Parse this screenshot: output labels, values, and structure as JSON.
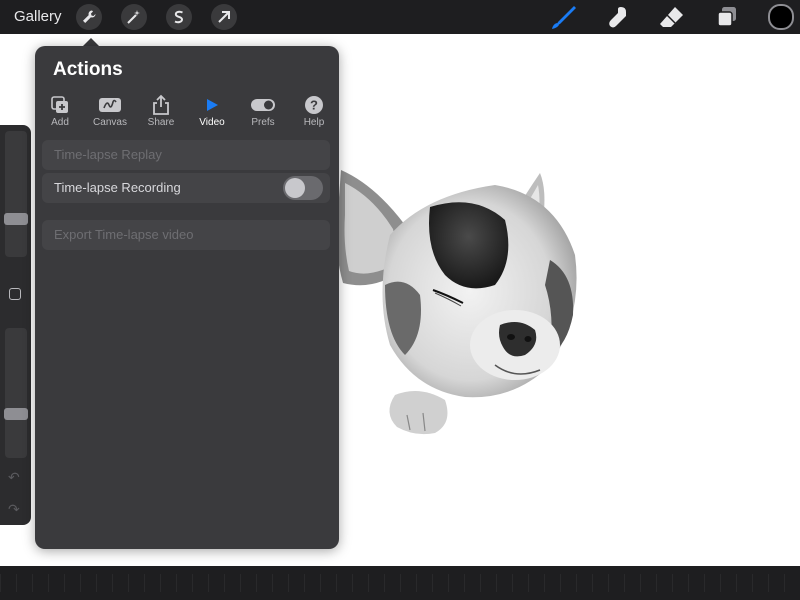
{
  "topbar": {
    "gallery_label": "Gallery"
  },
  "panel": {
    "title": "Actions",
    "tabs": [
      {
        "label": "Add",
        "icon": "add-icon",
        "active": false
      },
      {
        "label": "Canvas",
        "icon": "canvas-icon",
        "active": false
      },
      {
        "label": "Share",
        "icon": "share-icon",
        "active": false
      },
      {
        "label": "Video",
        "icon": "play-icon",
        "active": true
      },
      {
        "label": "Prefs",
        "icon": "toggle-icon",
        "active": false
      },
      {
        "label": "Help",
        "icon": "help-icon",
        "active": false
      }
    ],
    "rows": {
      "replay": "Time-lapse Replay",
      "recording": "Time-lapse Recording",
      "export": "Export Time-lapse video"
    },
    "recording_enabled": false
  },
  "colors": {
    "accent": "#1a7cf5",
    "panel_bg": "#3a3a3d",
    "row_bg": "#444447"
  }
}
